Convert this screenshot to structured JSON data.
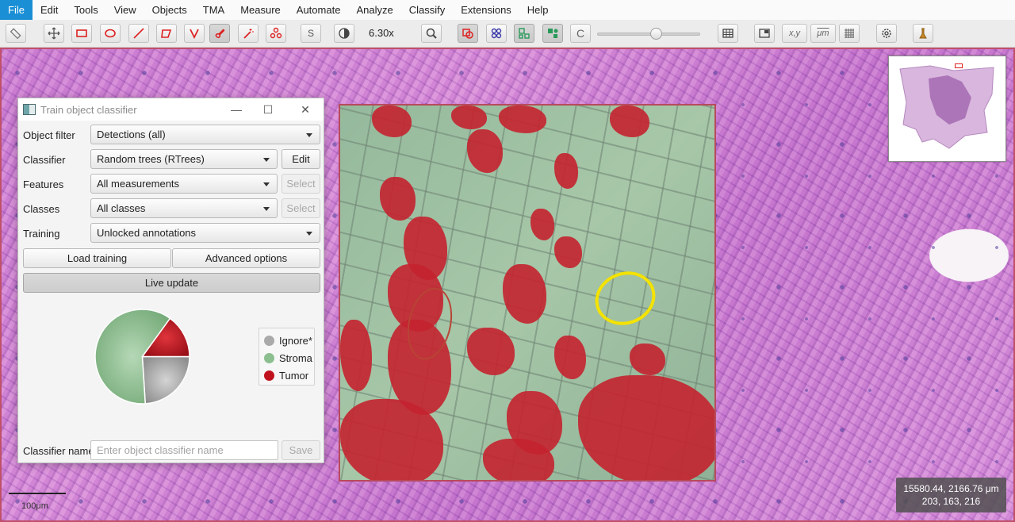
{
  "menubar": {
    "items": [
      "File",
      "Edit",
      "Tools",
      "View",
      "Objects",
      "TMA",
      "Measure",
      "Automate",
      "Analyze",
      "Classify",
      "Extensions",
      "Help"
    ],
    "active": "File"
  },
  "toolbar": {
    "icons": [
      "ruler-icon",
      "move-icon",
      "rectangle-icon",
      "ellipse-icon",
      "line-icon",
      "polygon-icon",
      "polyline-icon",
      "brush-icon",
      "wand-icon",
      "points-icon",
      "selection-mode-icon",
      "brightness-contrast-icon",
      "zoom-to-fit-icon",
      "show-annotations-icon",
      "show-tma-grid-icon",
      "show-detections-icon",
      "fill-detections-icon",
      "show-classification-icon",
      "measurement-table-icon",
      "show-overview-icon",
      "show-location-icon",
      "show-scalebar-icon",
      "show-grid-icon",
      "preferences-icon",
      "log-icon"
    ],
    "selection_mode_label": "S",
    "zoom": "6.30x",
    "classification_label": "C",
    "location_label": "x,y",
    "scalebar_label": "μm",
    "opacity_fraction": 0.55
  },
  "viewer": {
    "scalebar_label": "100μm",
    "coords_line1": "15580.44, 2166.76 μm",
    "coords_line2": "203, 163, 216"
  },
  "dialog": {
    "title": "Train object classifier",
    "object_filter_label": "Object filter",
    "object_filter_value": "Detections (all)",
    "classifier_label": "Classifier",
    "classifier_value": "Random trees (RTrees)",
    "edit_button": "Edit",
    "features_label": "Features",
    "features_value": "All measurements",
    "features_select": "Select",
    "classes_label": "Classes",
    "classes_value": "All classes",
    "classes_select": "Select",
    "training_label": "Training",
    "training_value": "Unlocked annotations",
    "load_training": "Load training",
    "advanced_options": "Advanced options",
    "live_update": "Live update",
    "classifier_name_label": "Classifier name",
    "classifier_name_placeholder": "Enter object classifier name",
    "classifier_name_value": "",
    "save_button": "Save"
  },
  "chart_data": {
    "type": "pie",
    "slices": [
      {
        "label": "Ignore*",
        "value": 24,
        "color": "#aaaaaa"
      },
      {
        "label": "Stroma",
        "value": 61,
        "color": "#8cbf8f"
      },
      {
        "label": "Tumor",
        "value": 15,
        "color": "#c0121d"
      }
    ],
    "legend_position": "right"
  },
  "colors": {
    "menu_active": "#1a8fd6",
    "yellow_annotation": "#f4e200",
    "tumor": "#c4222f",
    "stroma": "#8cbf8f"
  }
}
